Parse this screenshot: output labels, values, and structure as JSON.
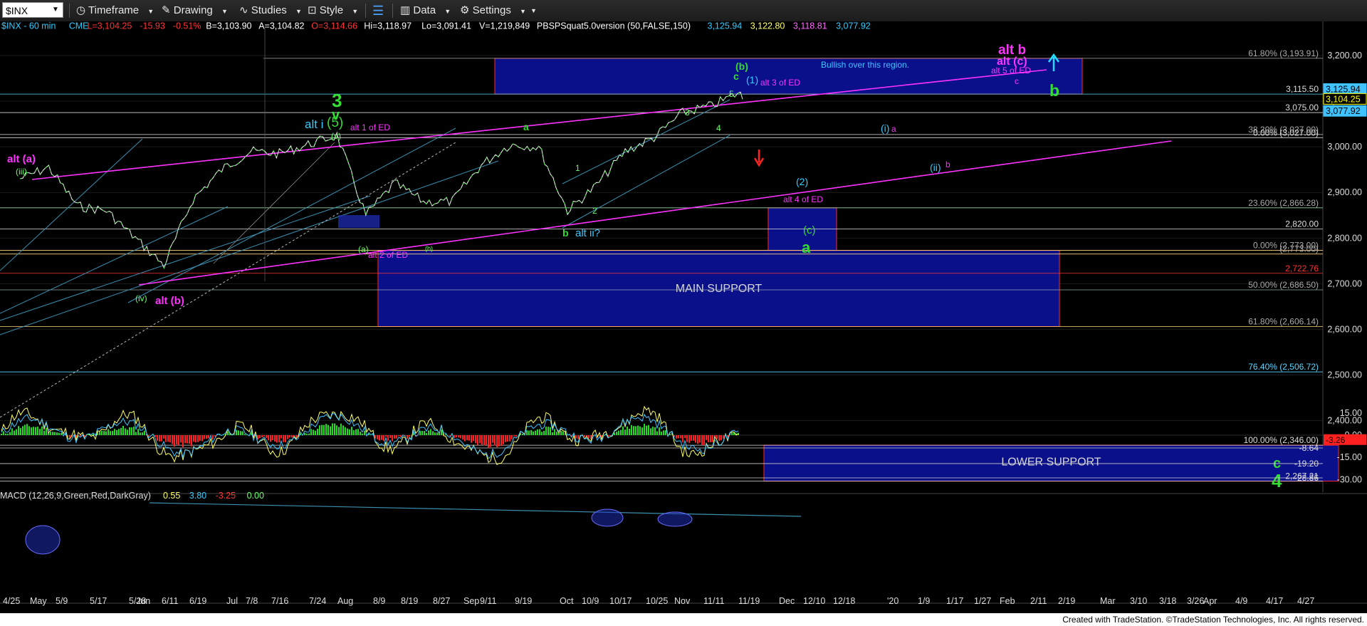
{
  "toolbar": {
    "symbol": "$INX",
    "timeframe_label": "Timeframe",
    "drawing_label": "Drawing",
    "studies_label": "Studies",
    "style_label": "Style",
    "data_label": "Data",
    "settings_label": "Settings"
  },
  "header": {
    "parts": [
      {
        "text": "$INX - 60 min",
        "color": "#33ccff"
      },
      {
        "text": "CME",
        "color": "#33ccff"
      },
      {
        "text": "L=3,104.25",
        "color": "#ff3333"
      },
      {
        "text": "-15.93",
        "color": "#ff3333"
      },
      {
        "text": "-0.51%",
        "color": "#ff3333"
      },
      {
        "text": "B=3,103.90",
        "color": "#ffffff"
      },
      {
        "text": "A=3,104.82",
        "color": "#ffffff"
      },
      {
        "text": "O=3,114.66",
        "color": "#ff3333"
      },
      {
        "text": "Hi=3,118.97",
        "color": "#ffffff"
      },
      {
        "text": "Lo=3,091.41",
        "color": "#ffffff"
      },
      {
        "text": "V=1,219,849",
        "color": "#ffffff"
      },
      {
        "text": "PBSPSquat5.0version (50,FALSE,150)",
        "color": "#ffffff"
      },
      {
        "text": "3,125.94",
        "color": "#33ccff"
      },
      {
        "text": "3,122.80",
        "color": "#ffff66"
      },
      {
        "text": "3,118.81",
        "color": "#ff66ff"
      },
      {
        "text": "3,077.92",
        "color": "#33ccff"
      }
    ]
  },
  "chart_data": [
    {
      "type": "line",
      "title": "$INX - 60 min",
      "y_axis_ticks": [
        3200,
        3100,
        3000,
        2900,
        2800,
        2700,
        2600,
        2500,
        2400
      ],
      "y_axis_tick_labels": [
        "3,200.00",
        "3,100.00",
        "3,000.00",
        "2,900.00",
        "2,800.00",
        "2,700.00",
        "2,600.00",
        "2,500.00",
        "2,400.00"
      ],
      "ylim": [
        2263,
        3245
      ],
      "x_axis_labels": [
        "4/25",
        "May",
        "5/9",
        "5/17",
        "5/28",
        "Jun",
        "6/11",
        "6/19",
        "Jul",
        "7/8",
        "7/16",
        "7/24",
        "Aug",
        "8/9",
        "8/19",
        "8/27",
        "Sep",
        "9/11",
        "9/19",
        "Oct",
        "10/9",
        "10/17",
        "10/25",
        "Nov",
        "11/11",
        "11/19",
        "Dec",
        "12/10",
        "12/18",
        "'20",
        "1/9",
        "1/17",
        "1/27",
        "Feb",
        "2/11",
        "2/19",
        "Mar",
        "3/10",
        "3/18",
        "3/26",
        "Apr",
        "4/9",
        "4/17",
        "4/27"
      ],
      "price_path": [
        [
          "4/25",
          2930
        ],
        [
          "May",
          2955
        ],
        [
          "5/9",
          2870
        ],
        [
          "5/17",
          2860
        ],
        [
          "5/28",
          2800
        ],
        [
          "Jun",
          2740
        ],
        [
          "6/11",
          2885
        ],
        [
          "6/19",
          2950
        ],
        [
          "Jul",
          2990
        ],
        [
          "7/8",
          2985
        ],
        [
          "7/16",
          3005
        ],
        [
          "7/24",
          3025
        ],
        [
          "Aug",
          2850
        ],
        [
          "8/9",
          2920
        ],
        [
          "8/19",
          2880
        ],
        [
          "8/27",
          2880
        ],
        [
          "Sep",
          2960
        ],
        [
          "9/11",
          3005
        ],
        [
          "9/19",
          3000
        ],
        [
          "Oct",
          2860
        ],
        [
          "10/9",
          2915
        ],
        [
          "10/17",
          2990
        ],
        [
          "10/25",
          3020
        ],
        [
          "Nov",
          3075
        ],
        [
          "11/11",
          3090
        ],
        [
          "11/19",
          3120
        ]
      ],
      "last_price": 3104.25,
      "price_markers": [
        {
          "label": "3,125.94",
          "value": 3125.94,
          "color": "#3fc2ff"
        },
        {
          "label": "3,104.25",
          "value": 3104.25,
          "color": "#ffff00"
        },
        {
          "label": "3,077.92",
          "value": 3077.92,
          "color": "#3fc2ff"
        }
      ],
      "fib_levels": [
        {
          "label": "61.80% (3,193.91)",
          "value": 3193.91
        },
        {
          "label": "3,115.50",
          "value": 3115.5
        },
        {
          "label": "3,075.00",
          "value": 3075.0
        },
        {
          "label": "38.20% (3,027.00)",
          "value": 3027.0
        },
        {
          "label": "0.00% (3,027.00)",
          "value": 3020.0
        },
        {
          "label": "23.60% (2,866.28)",
          "value": 2866.28
        },
        {
          "label": "2,820.00",
          "value": 2820.0
        },
        {
          "label": "0.00% (2,773.00)",
          "value": 2773.0
        },
        {
          "label": "(2,773.00)",
          "value": 2765.0
        },
        {
          "label": "2,722.76",
          "value": 2722.76
        },
        {
          "label": "50.00% (2,686.50)",
          "value": 2686.5
        },
        {
          "label": "61.80% (2,606.14)",
          "value": 2606.14
        },
        {
          "label": "76.40% (2,506.72)",
          "value": 2506.72
        },
        {
          "label": "100.00% (2,346.00)",
          "value": 2346.0
        },
        {
          "label": "2,267.21",
          "value": 2267.21
        }
      ],
      "zones": [
        {
          "label": "Bullish over this region.",
          "top": 3193.91,
          "bottom": 3115.5
        },
        {
          "label": "MAIN SUPPORT",
          "top": 2773.0,
          "bottom": 2606.14
        },
        {
          "label": "LOWER SUPPORT",
          "top": 2346.0,
          "bottom": 2267.21
        },
        {
          "label": "",
          "top": 2866.28,
          "bottom": 2773.0
        }
      ],
      "wave_labels": [
        {
          "text": "alt (a)",
          "color": "#ff33ff"
        },
        {
          "text": "(iii)",
          "color": "#66ff66"
        },
        {
          "text": "(iv)",
          "color": "#66ff66"
        },
        {
          "text": "alt (b)",
          "color": "#ff33ff"
        },
        {
          "text": "3",
          "color": "#33dd33"
        },
        {
          "text": "v",
          "color": "#33dd33"
        },
        {
          "text": "alt i",
          "color": "#33ccff"
        },
        {
          "text": "(5)",
          "color": "#33dd33"
        },
        {
          "text": "alt 1 of ED",
          "color": "#ff33ff"
        },
        {
          "text": "(v)",
          "color": "#66ff66"
        },
        {
          "text": "(a)",
          "color": "#66ff66"
        },
        {
          "text": "(b)",
          "color": "#66ff66"
        },
        {
          "text": "alt 2 of ED",
          "color": "#ff33ff"
        },
        {
          "text": "a",
          "color": "#33dd33"
        },
        {
          "text": "b",
          "color": "#33dd33"
        },
        {
          "text": "alt ii?",
          "color": "#33ccff"
        },
        {
          "text": "1",
          "color": "#66ff66"
        },
        {
          "text": "2",
          "color": "#66ff66"
        },
        {
          "text": "3",
          "color": "#66ff66"
        },
        {
          "text": "4",
          "color": "#66ff66"
        },
        {
          "text": "5",
          "color": "#66ff66"
        },
        {
          "text": "c",
          "color": "#33dd33"
        },
        {
          "text": "(b)",
          "color": "#33dd33"
        },
        {
          "text": "(1)",
          "color": "#33ccff"
        },
        {
          "text": "alt 3 of ED",
          "color": "#ff33ff"
        },
        {
          "text": "(2)",
          "color": "#33ccff"
        },
        {
          "text": "alt 4 of ED",
          "color": "#ff33ff"
        },
        {
          "text": "(c)",
          "color": "#33dd33"
        },
        {
          "text": "a",
          "color": "#33dd33"
        },
        {
          "text": "(i)",
          "color": "#33ccff"
        },
        {
          "text": "a",
          "color": "#ff33ff"
        },
        {
          "text": "(ii)",
          "color": "#33ccff"
        },
        {
          "text": "b",
          "color": "#ff33ff"
        },
        {
          "text": "alt b",
          "color": "#ff33ff"
        },
        {
          "text": "alt (c)",
          "color": "#ff33ff"
        },
        {
          "text": "alt 5 of ED",
          "color": "#ff33ff"
        },
        {
          "text": "c",
          "color": "#ff33ff"
        },
        {
          "text": "b",
          "color": "#33dd33"
        },
        {
          "text": "c",
          "color": "#33dd33"
        },
        {
          "text": "4",
          "color": "#33dd33"
        }
      ]
    },
    {
      "type": "line",
      "title": "MACD (12,26,9,Green,Red,DarkGray)",
      "legend_values": [
        {
          "text": "0.55",
          "color": "#ffff66"
        },
        {
          "text": "3.80",
          "color": "#33ccff"
        },
        {
          "text": "-3.25",
          "color": "#ff3333"
        },
        {
          "text": "0.00",
          "color": "#66ff66"
        }
      ],
      "y_axis_ticks": [
        15,
        0,
        -15,
        -30
      ],
      "y_axis_tick_labels": [
        "15.00",
        "0.00",
        "-15.00",
        "-30.00"
      ],
      "ylim": [
        -34,
        22
      ],
      "levels": [
        {
          "label": "-8.64",
          "value": -8.64
        },
        {
          "label": "-19.20",
          "value": -19.2
        },
        {
          "label": "-28.86",
          "value": -28.86
        }
      ],
      "current_marker": {
        "label": "-3.26",
        "value": -3.26
      }
    }
  ],
  "footer": {
    "text": "Created with TradeStation. ©TradeStation Technologies, Inc. All rights reserved."
  }
}
